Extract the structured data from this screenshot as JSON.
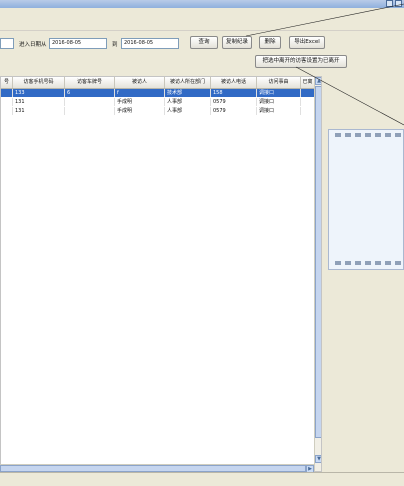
{
  "window": {
    "title": ""
  },
  "filters": {
    "entry_date_from_label": "进入日期从",
    "entry_date_from_value": "2016-08-05",
    "to_label": "到",
    "entry_date_to_value": "2016-08-05"
  },
  "toolbar": {
    "query_label": "查询",
    "copy_label": "复制纪录",
    "delete_label": "删除",
    "export_label": "导出Excel",
    "set_left_label": "把选中离开的访客设置为已离开"
  },
  "table": {
    "columns": [
      "号",
      "访客手机号码",
      "访客车牌号",
      "被访人",
      "被访人所在部门",
      "被访人电话",
      "访问事由",
      "已离"
    ],
    "rows": [
      [
        "",
        "133",
        "6",
        "f",
        "技术部",
        "158",
        "调接口",
        ""
      ],
      [
        "",
        "131",
        "",
        "手成明",
        "人事部",
        "0579",
        "调接口",
        ""
      ],
      [
        "",
        "131",
        "",
        "手成明",
        "人事部",
        "0579",
        "调接口",
        ""
      ]
    ]
  },
  "icons": {
    "minimize": "minimize-icon",
    "close": "close-icon",
    "scroll_up": "chevron-up-icon",
    "scroll_down": "chevron-down-icon",
    "scroll_right": "chevron-right-icon"
  },
  "colors": {
    "selection": "#316ac5",
    "window_bg": "#ece9d8"
  }
}
